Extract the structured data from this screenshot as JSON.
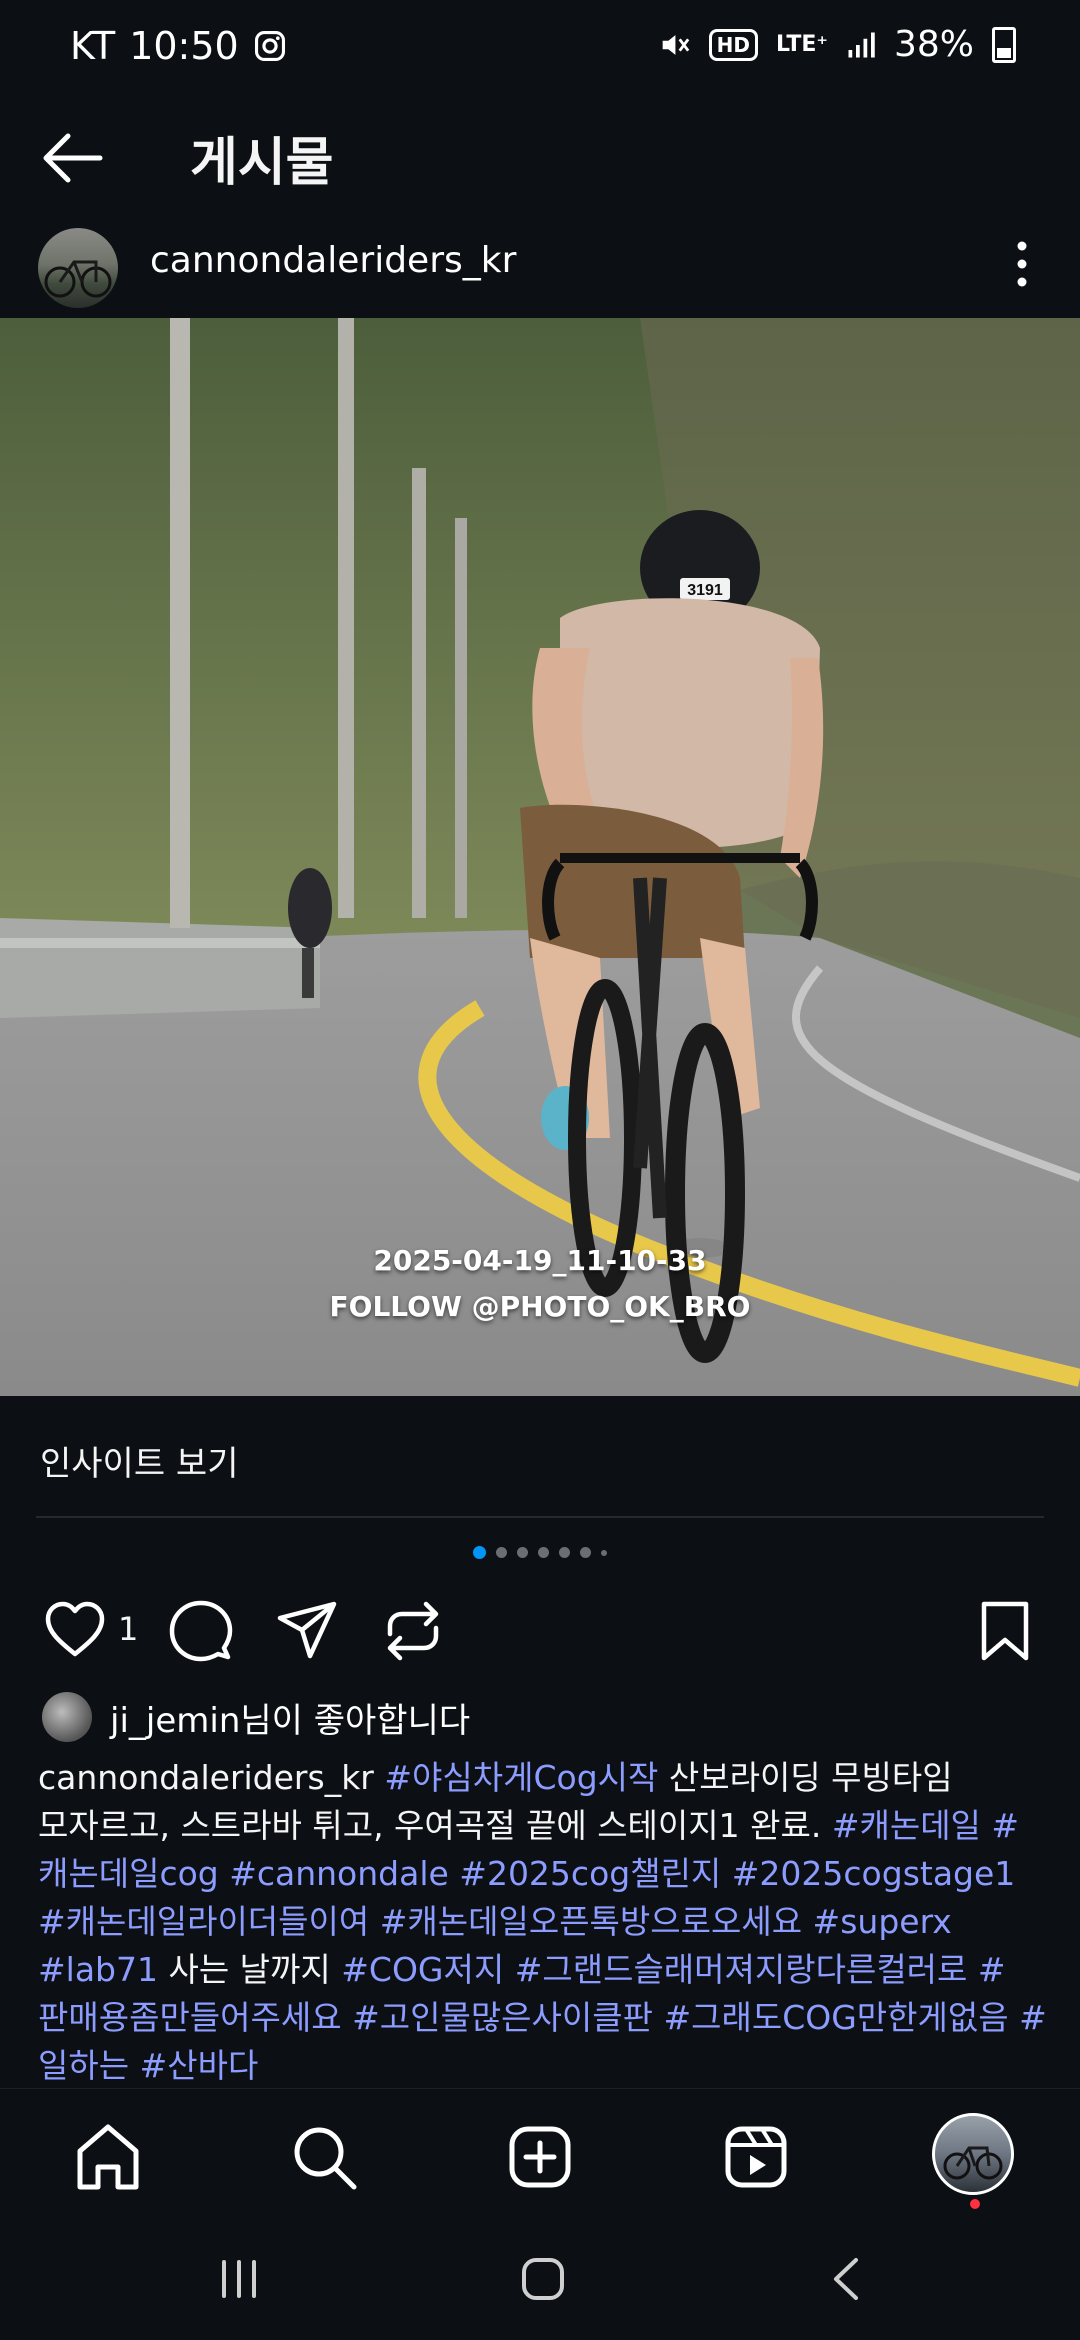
{
  "status_bar": {
    "carrier": "KT",
    "time": "10:50",
    "network": "LTE⁺",
    "battery": "38%"
  },
  "header": {
    "title": "게시물"
  },
  "post": {
    "username": "cannondaleriders_kr",
    "photo_overlay_line1": "2025-04-19_11-10-33",
    "photo_overlay_line2": "FOLLOW @PHOTO_OK_BRO",
    "bib_number": "3191",
    "insights_label": "인사이트 보기",
    "carousel": {
      "count": 7,
      "active_index": 0
    },
    "like_count": "1",
    "liked_by_user": "ji_jemin",
    "liked_by_suffix": "님이 좋아합니다",
    "caption": {
      "author": "cannondaleriders_kr",
      "tag1": "#야심차게Cog시작",
      "text1": " 산보라이딩 무빙타임 모자르고, 스트라바 튀고, 우여곡절 끝에 스테이지1 완료.",
      "tags2": "#캐논데일 #캐논데일cog #cannondale #2025cog챌린지 #2025cogstage1 #캐논데일라이더들이여 #캐논데일오픈톡방으로오세요 #superx #lab71",
      "text2": " 사는 날까지 ",
      "tags3": "#COG저지 #그랜드슬래머져지랑다른컬러로 #판매용좀만들어주세요 #고인물많은사이클판 #그래도COG만한게없음 #일하는 #산바다"
    }
  },
  "colors": {
    "background": "#0c1014",
    "hashtag": "#8c9cff",
    "active_dot": "#0095f6",
    "notification": "#ff3040"
  }
}
